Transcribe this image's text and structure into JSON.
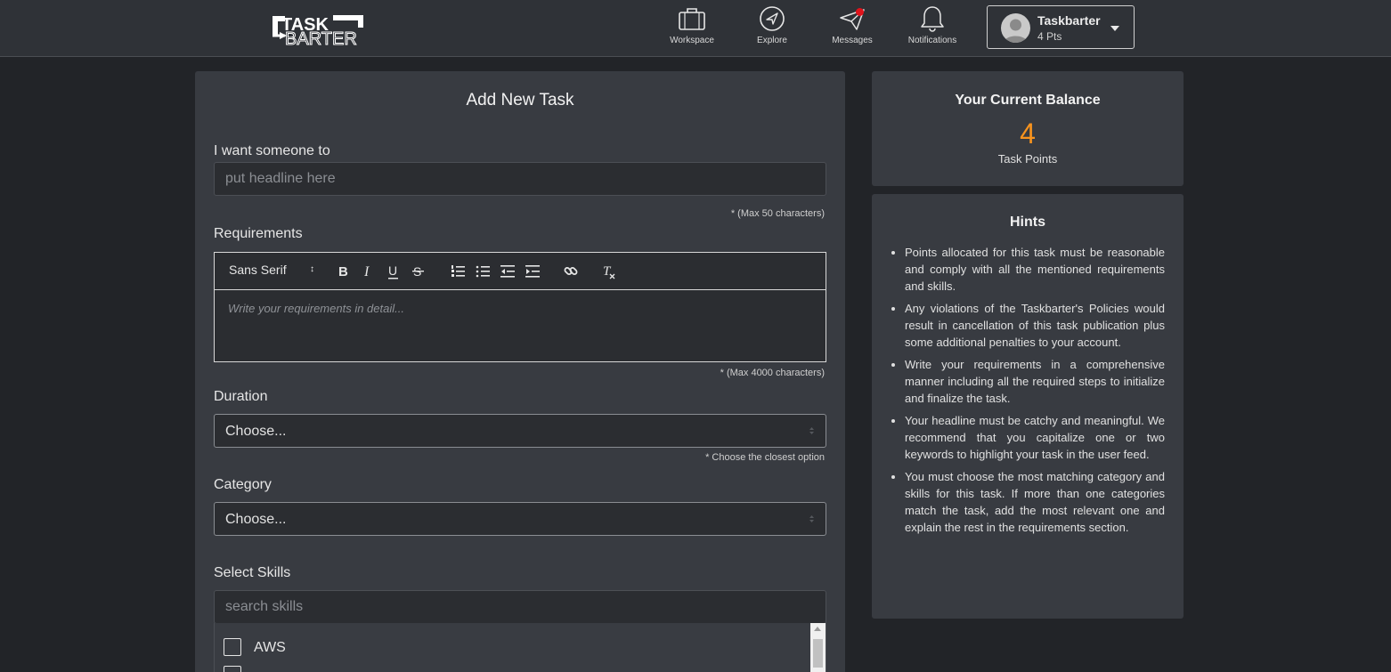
{
  "header": {
    "logo_text": "TASK BARTER",
    "nav": [
      {
        "label": "Workspace",
        "icon": "briefcase-icon"
      },
      {
        "label": "Explore",
        "icon": "compass-icon"
      },
      {
        "label": "Messages",
        "icon": "paper-plane-icon"
      },
      {
        "label": "Notifications",
        "icon": "bell-icon"
      }
    ],
    "user": {
      "name": "Taskbarter",
      "points": "4 Pts"
    }
  },
  "form": {
    "title": "Add New Task",
    "headline": {
      "label": "I want someone to",
      "placeholder": "put headline here",
      "note": "* (Max 50 characters)"
    },
    "requirements": {
      "label": "Requirements",
      "font": "Sans Serif",
      "placeholder": "Write your requirements in detail...",
      "note": "* (Max 4000 characters)"
    },
    "duration": {
      "label": "Duration",
      "value": "Choose...",
      "note": "* Choose the closest option"
    },
    "category": {
      "label": "Category",
      "value": "Choose..."
    },
    "skills": {
      "label": "Select Skills",
      "placeholder": "search skills",
      "items": [
        "AWS"
      ]
    }
  },
  "balance": {
    "title": "Your Current Balance",
    "value": "4",
    "unit": "Task Points"
  },
  "hints": {
    "title": "Hints",
    "items": [
      "Points allocated for this task must be reasonable and comply with all the mentioned requirements and skills.",
      "Any violations of the Taskbarter's Policies would result in cancellation of this task publication plus some additional penalties to your account.",
      "Write your requirements in a comprehensive manner including all the required steps to initialize and finalize the task.",
      "Your headline must be catchy and meaningful. We recommend that you capitalize one or two keywords to highlight your task in the user feed.",
      "You must choose the most matching category and skills for this task. If more than one categories match the task, add the most relevant one and explain the rest in the requirements section."
    ]
  },
  "colors": {
    "accent": "#f7931e",
    "notification_dot": "#e0131b",
    "background": "#222428",
    "card": "#383b41"
  }
}
